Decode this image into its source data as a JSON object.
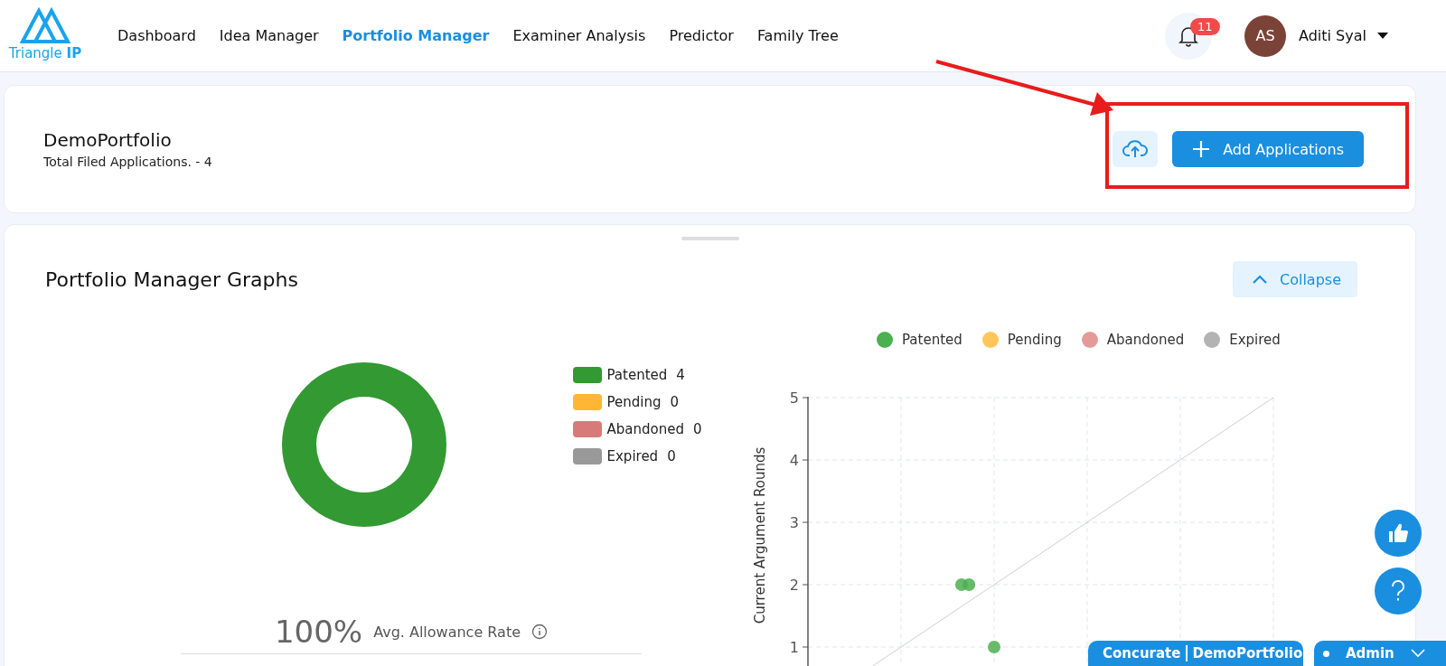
{
  "header": {
    "logo": {
      "text": "Triangle",
      "bold": "IP"
    },
    "nav": [
      {
        "label": "Dashboard",
        "selected": false
      },
      {
        "label": "Idea Manager",
        "selected": false
      },
      {
        "label": "Portfolio Manager",
        "selected": true
      },
      {
        "label": "Examiner Analysis",
        "selected": false
      },
      {
        "label": "Predictor",
        "selected": false
      },
      {
        "label": "Family Tree",
        "selected": false
      }
    ],
    "notifications": {
      "count": "11"
    },
    "user": {
      "initials": "AS",
      "name": "Aditi Syal"
    }
  },
  "portfolio": {
    "name": "DemoPortfolio",
    "subtitle": "Total Filed Applications. - 4",
    "add_button": "Add Applications"
  },
  "graphs": {
    "title": "Portfolio Manager Graphs",
    "collapse_button": "Collapse",
    "status_chart": {
      "legend": [
        {
          "label": "Patented",
          "count": "4",
          "color": "#339933"
        },
        {
          "label": "Pending",
          "count": "0",
          "color": "#ffb733"
        },
        {
          "label": "Abandoned",
          "count": "0",
          "color": "#d97a7a"
        },
        {
          "label": "Expired",
          "count": "0",
          "color": "#999999"
        }
      ]
    },
    "stats": [
      {
        "value": "100%",
        "label": "Avg. Allowance Rate"
      }
    ],
    "rounds_chart": {
      "ylabel": "Current Argument Rounds",
      "yticks": [
        "5",
        "4",
        "3",
        "2",
        "1"
      ],
      "legend": [
        {
          "name": "Patented",
          "color": "#4caf50"
        },
        {
          "name": "Pending",
          "color": "#ffc658"
        },
        {
          "name": "Abandoned",
          "color": "#e59a9a"
        },
        {
          "name": "Expired",
          "color": "#b3b3b3"
        }
      ]
    }
  },
  "footer_tabs": [
    {
      "kind": "project",
      "label": "Concurate",
      "project": "DemoPortfolio"
    },
    {
      "kind": "role",
      "label": "Admin"
    }
  ]
}
